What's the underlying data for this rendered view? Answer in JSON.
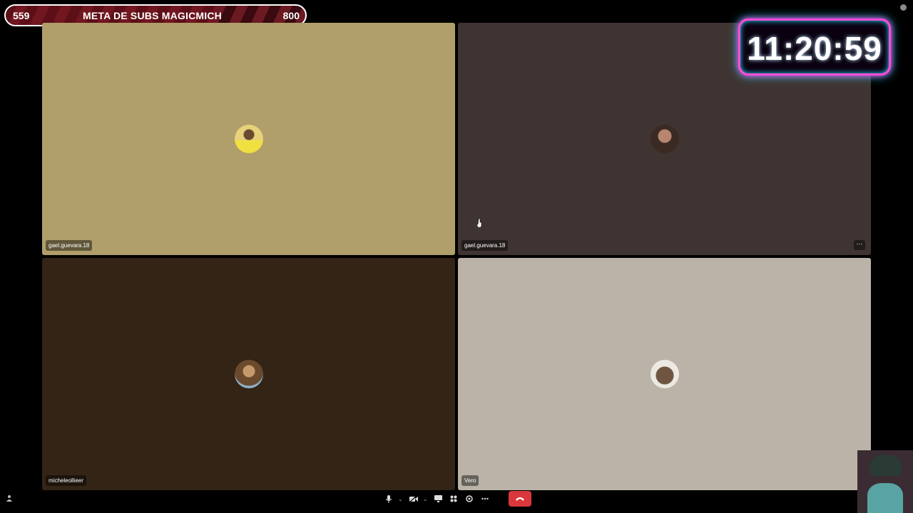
{
  "sub_goal": {
    "current": "559",
    "title": "META DE SUBS MAGICMICH",
    "goal": "800",
    "progress": 0.699
  },
  "timer": {
    "display": "11:20:59"
  },
  "tiles": [
    {
      "name": "gael.guevara.18"
    },
    {
      "name": "gael.guevara.18"
    },
    {
      "name": "micheleollieer"
    },
    {
      "name": "Vero"
    }
  ],
  "tile_menu": {
    "icon": "more-options-icon",
    "glyph": "⋯"
  },
  "controls": {
    "mic_icon": "microphone-icon",
    "camera_icon": "camera-off-icon",
    "share_icon": "screen-share-icon",
    "activity_icon": "activities-icon",
    "soundboard_icon": "soundboard-icon",
    "more_icon": "more-icon",
    "disconnect_icon": "disconnect-icon"
  },
  "colors": {
    "tile1": "#b09e6b",
    "tile2": "#3f3431",
    "tile3": "#332416",
    "tile4": "#bbb3a8",
    "disconnect": "#da373c",
    "clock_border": "#ff4fd8",
    "clock_glow": "#25d8ff"
  }
}
